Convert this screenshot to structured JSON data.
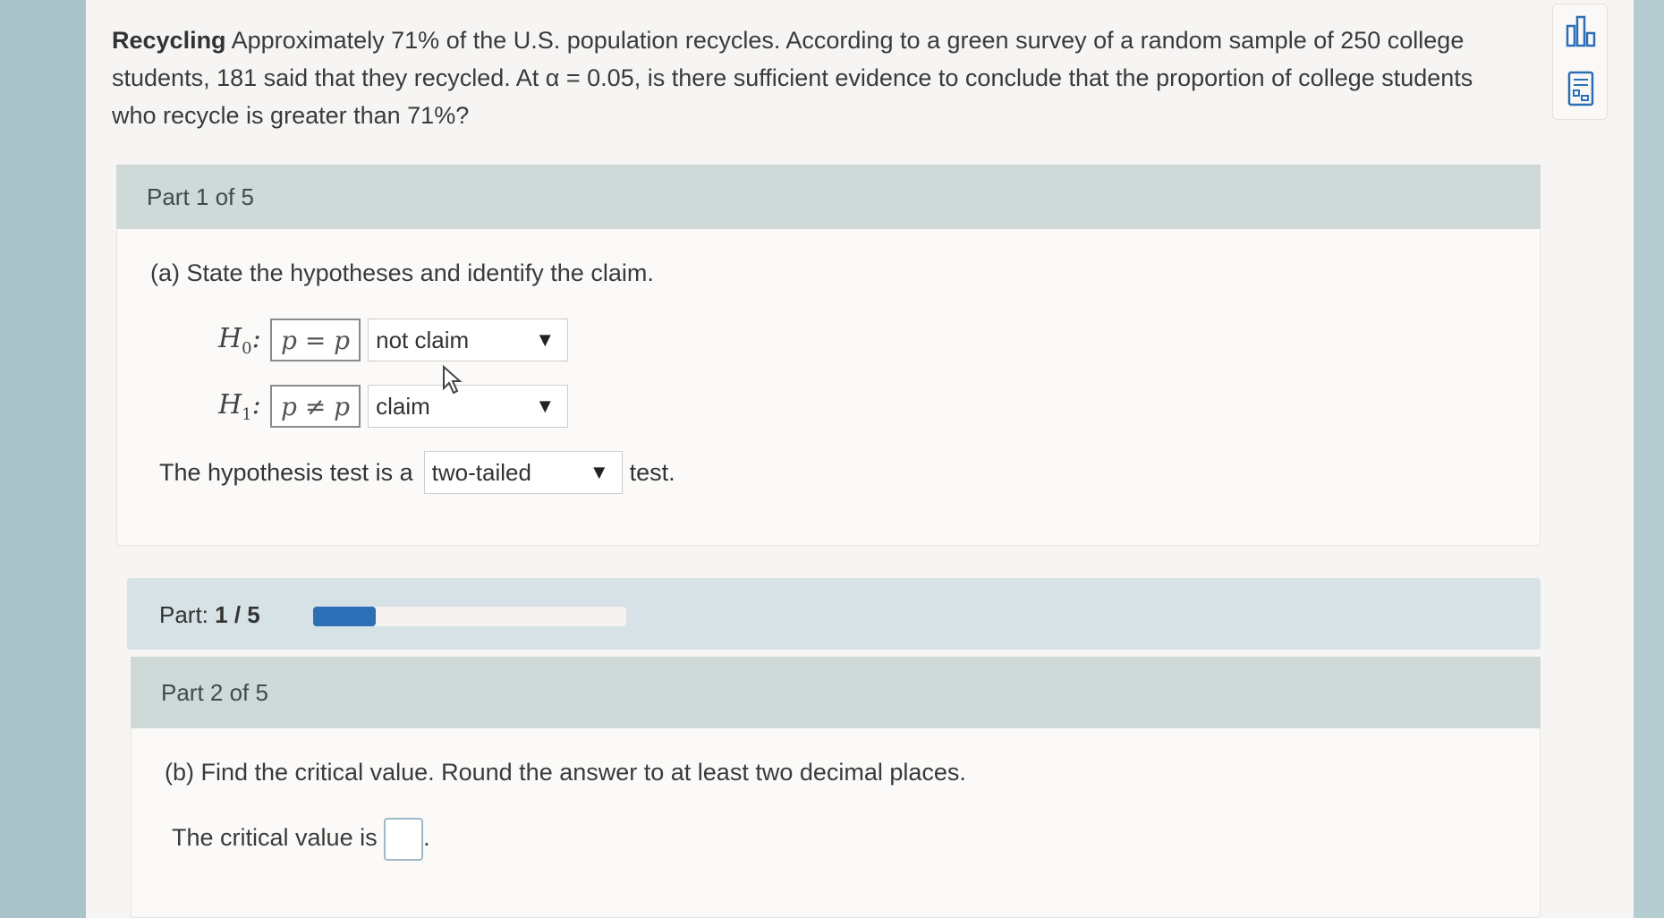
{
  "problem": {
    "title": "Recycling",
    "text_line1": "Approximately 71% of the U.S. population recycles. According to a green survey of a random sample of 250 college",
    "text_line2": "students, 181 said that they recycled. At α = 0.05, is there sufficient evidence to conclude that the proportion of college students",
    "text_line3": "who recycle is greater than 71%?"
  },
  "toolbox": {
    "icons": [
      "bar-chart-icon",
      "calculator-icon"
    ]
  },
  "part1": {
    "header": "Part 1 of 5",
    "question": "(a) State the hypotheses and identify the claim.",
    "h0": {
      "label": "H",
      "sub": "0",
      "expression": "p = p",
      "selection": "not claim"
    },
    "h1": {
      "label": "H",
      "sub": "1",
      "expression": "p ≠ p",
      "selection": "claim"
    },
    "test_prefix": "The hypothesis test is a",
    "test_selection": "two-tailed",
    "test_suffix": "test."
  },
  "progress": {
    "label": "Part:",
    "value": "1 / 5",
    "fraction": 0.2
  },
  "part2": {
    "header": "Part 2 of 5",
    "question": "(b) Find the critical value. Round the answer to at least two decimal places.",
    "answer_prefix": "The critical value is",
    "answer_value": ""
  },
  "colors": {
    "accent": "#2d6fb6",
    "panel_header": "#cfd9d8",
    "progress_bg": "#d7e2e6"
  }
}
